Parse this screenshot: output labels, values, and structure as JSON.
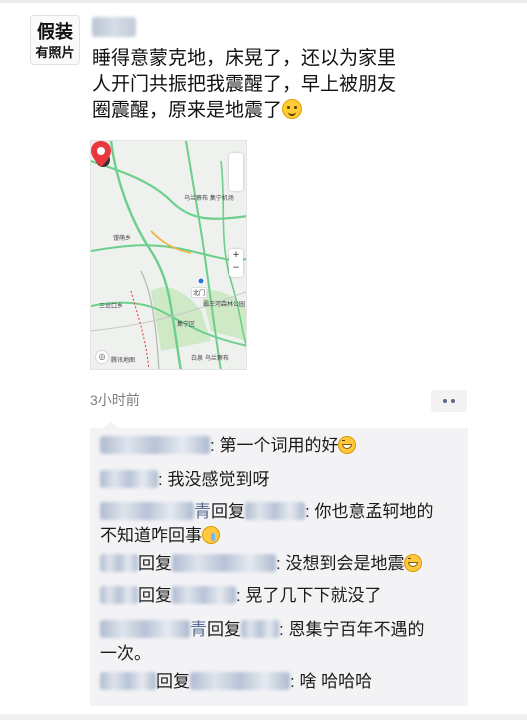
{
  "avatar": {
    "line1": "假装",
    "line2": "有照片"
  },
  "post": {
    "line1": "睡得意蒙克地，床晃了，还以为家里",
    "line2": "人开门共振把我震醒了，早上被朋友",
    "line3": "圈震醒，原来是地震了",
    "emoji_icon": "smiling-emoji-icon"
  },
  "map": {
    "labels": {
      "airport": "乌兰察布 集宁机场",
      "township": "馒萌乡",
      "district": "集宁区",
      "lake": "三岔口乡",
      "station": "乌兰察布火车站",
      "park": "霸王河森林公园",
      "pin": "北门",
      "corner": "白泉 乌兰察布",
      "logo": "腾讯地图"
    },
    "colors": {
      "road": "#6ccf8c",
      "highway": "#f0b23c",
      "park": "#cfe9c7",
      "pin": "#e8383d"
    }
  },
  "meta": {
    "timestamp": "3小时前",
    "more_icon": "more-dots-icon"
  },
  "comments": [
    {
      "author_blurred": true,
      "separator": ": ",
      "text": "第一个词用的好",
      "emoji": "grin-emoji-icon"
    },
    {
      "author_blurred": true,
      "separator": ": ",
      "text": "我没感觉到呀"
    },
    {
      "author_blurred": true,
      "author_tail": "青",
      "reply_word": "回复",
      "separator": ": ",
      "text": "你也意孟轲地的",
      "text2": "不知道咋回事",
      "emoji": "cry-emoji-icon"
    },
    {
      "author_blurred": true,
      "reply_word": "回复",
      "separator": ": ",
      "text": "没想到会是地震",
      "emoji": "grin-emoji-icon"
    },
    {
      "author_blurred": true,
      "reply_word": "回复",
      "separator": ": ",
      "text": "晃了几下下就没了"
    },
    {
      "author_blurred": true,
      "author_tail": "青",
      "reply_word": "回复",
      "separator": ": ",
      "text": "恩集宁百年不遇的",
      "text2": "一次。"
    },
    {
      "author_blurred": true,
      "reply_word": "回复",
      "separator": ": ",
      "text": "啥 哈哈哈"
    }
  ]
}
